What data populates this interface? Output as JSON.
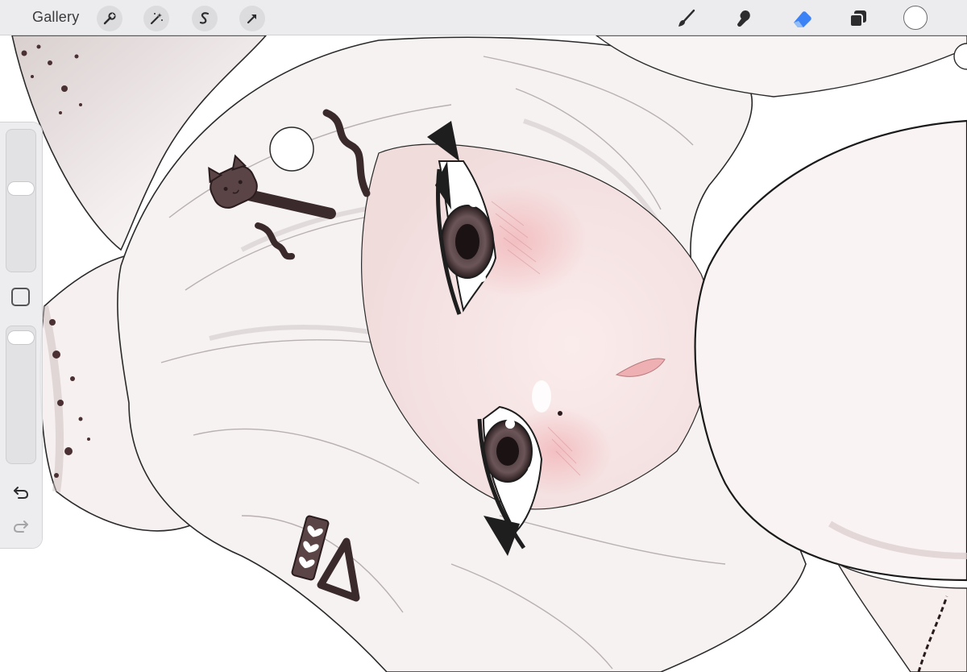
{
  "app": {
    "gallery_label": "Gallery"
  },
  "toolbar": {
    "left_tools": [
      {
        "name": "actions",
        "icon": "wrench-icon"
      },
      {
        "name": "adjustments",
        "icon": "magic-wand-icon"
      },
      {
        "name": "selection",
        "icon": "selection-s-icon"
      },
      {
        "name": "transform",
        "icon": "arrow-cursor-icon"
      }
    ],
    "right_tools": [
      {
        "name": "brush",
        "icon": "brush-icon",
        "active": false
      },
      {
        "name": "smudge",
        "icon": "smudge-finger-icon",
        "active": false
      },
      {
        "name": "eraser",
        "icon": "eraser-icon",
        "active": true
      },
      {
        "name": "layers",
        "icon": "layers-icon",
        "active": false
      }
    ],
    "current_color": "#ffffff"
  },
  "sidebar": {
    "brush_size_level": 0.08,
    "opacity_level": 0.0,
    "modifier_icon": "square-modifier-icon",
    "undo_icon": "undo-icon",
    "redo_icon": "redo-icon"
  },
  "colors": {
    "active_tool": "#3b82f6",
    "toolbar_bg": "#ebebed",
    "icon": "#2c2c2e"
  }
}
